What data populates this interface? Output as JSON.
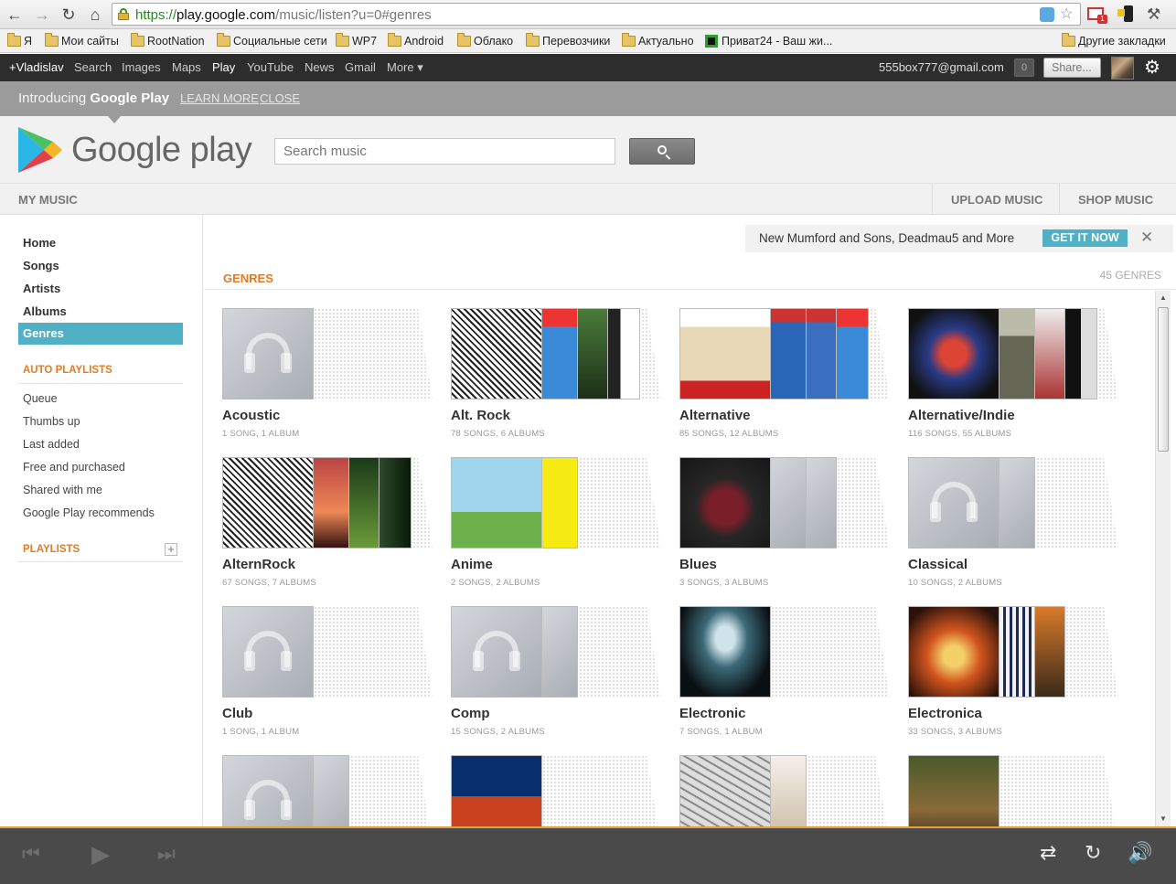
{
  "browser": {
    "url_scheme": "https://",
    "url_host": "play.google.com",
    "url_path": "/music/listen?u=0#genres"
  },
  "bookmarks": [
    {
      "label": "Я",
      "icon": "folder-icon"
    },
    {
      "label": "Мои сайты",
      "icon": "folder-icon"
    },
    {
      "label": "RootNation",
      "icon": "folder-icon"
    },
    {
      "label": "Социальные сети",
      "icon": "folder-icon"
    },
    {
      "label": "WP7",
      "icon": "folder-icon"
    },
    {
      "label": "Android",
      "icon": "folder-icon"
    },
    {
      "label": "Облако",
      "icon": "folder-icon"
    },
    {
      "label": "Перевозчики",
      "icon": "folder-icon"
    },
    {
      "label": "Актуально",
      "icon": "folder-icon"
    },
    {
      "label": "Приват24 - Ваш жи...",
      "icon": "privat24-icon"
    },
    {
      "label": "Другие закладки",
      "icon": "folder-icon"
    }
  ],
  "gbar": {
    "links": [
      "+Vladislav",
      "Search",
      "Images",
      "Maps",
      "Play",
      "YouTube",
      "News",
      "Gmail",
      "More ▾"
    ],
    "email": "555box777@gmail.com",
    "notifications": "0",
    "share": "Share..."
  },
  "intro": {
    "prefix": "Introducing ",
    "brand": "Google Play",
    "learn_more": "LEARN MORE",
    "close": "CLOSE"
  },
  "header": {
    "logo_text": "Google play",
    "search_placeholder": "Search music"
  },
  "subnav": {
    "my_music": "MY MUSIC",
    "upload": "UPLOAD MUSIC",
    "shop": "SHOP MUSIC"
  },
  "sidebar": {
    "nav": [
      "Home",
      "Songs",
      "Artists",
      "Albums",
      "Genres"
    ],
    "auto_playlists_title": "AUTO PLAYLISTS",
    "auto_playlists": [
      "Queue",
      "Thumbs up",
      "Last added",
      "Free and purchased",
      "Shared with me",
      "Google Play recommends"
    ],
    "playlists_title": "PLAYLISTS"
  },
  "promo": {
    "text": "New Mumford and Sons, Deadmau5 and More",
    "button": "GET IT NOW"
  },
  "main": {
    "title": "GENRES",
    "count": "45 GENRES"
  },
  "genres": [
    {
      "name": "Acoustic",
      "meta": "1 SONG, 1 ALBUM"
    },
    {
      "name": "Alt. Rock",
      "meta": "78 SONGS, 6 ALBUMS"
    },
    {
      "name": "Alternative",
      "meta": "85 SONGS, 12 ALBUMS"
    },
    {
      "name": "Alternative/Indie",
      "meta": "116 SONGS, 55 ALBUMS"
    },
    {
      "name": "AlternRock",
      "meta": "67 SONGS, 7 ALBUMS"
    },
    {
      "name": "Anime",
      "meta": "2 SONGS, 2 ALBUMS"
    },
    {
      "name": "Blues",
      "meta": "3 SONGS, 3 ALBUMS"
    },
    {
      "name": "Classical",
      "meta": "10 SONGS, 2 ALBUMS"
    },
    {
      "name": "Club",
      "meta": "1 SONG, 1 ALBUM"
    },
    {
      "name": "Comp",
      "meta": "15 SONGS, 2 ALBUMS"
    },
    {
      "name": "Electronic",
      "meta": "7 SONGS, 1 ALBUM"
    },
    {
      "name": "Electronica",
      "meta": "33 SONGS, 3 ALBUMS"
    },
    {
      "name": "",
      "meta": ""
    },
    {
      "name": "",
      "meta": ""
    },
    {
      "name": "",
      "meta": ""
    },
    {
      "name": "",
      "meta": ""
    }
  ],
  "colors": {
    "accent_orange": "#e07b26",
    "accent_teal": "#4fb0c6",
    "gbar": "#2d2d2d",
    "player": "#4a4a4a"
  }
}
